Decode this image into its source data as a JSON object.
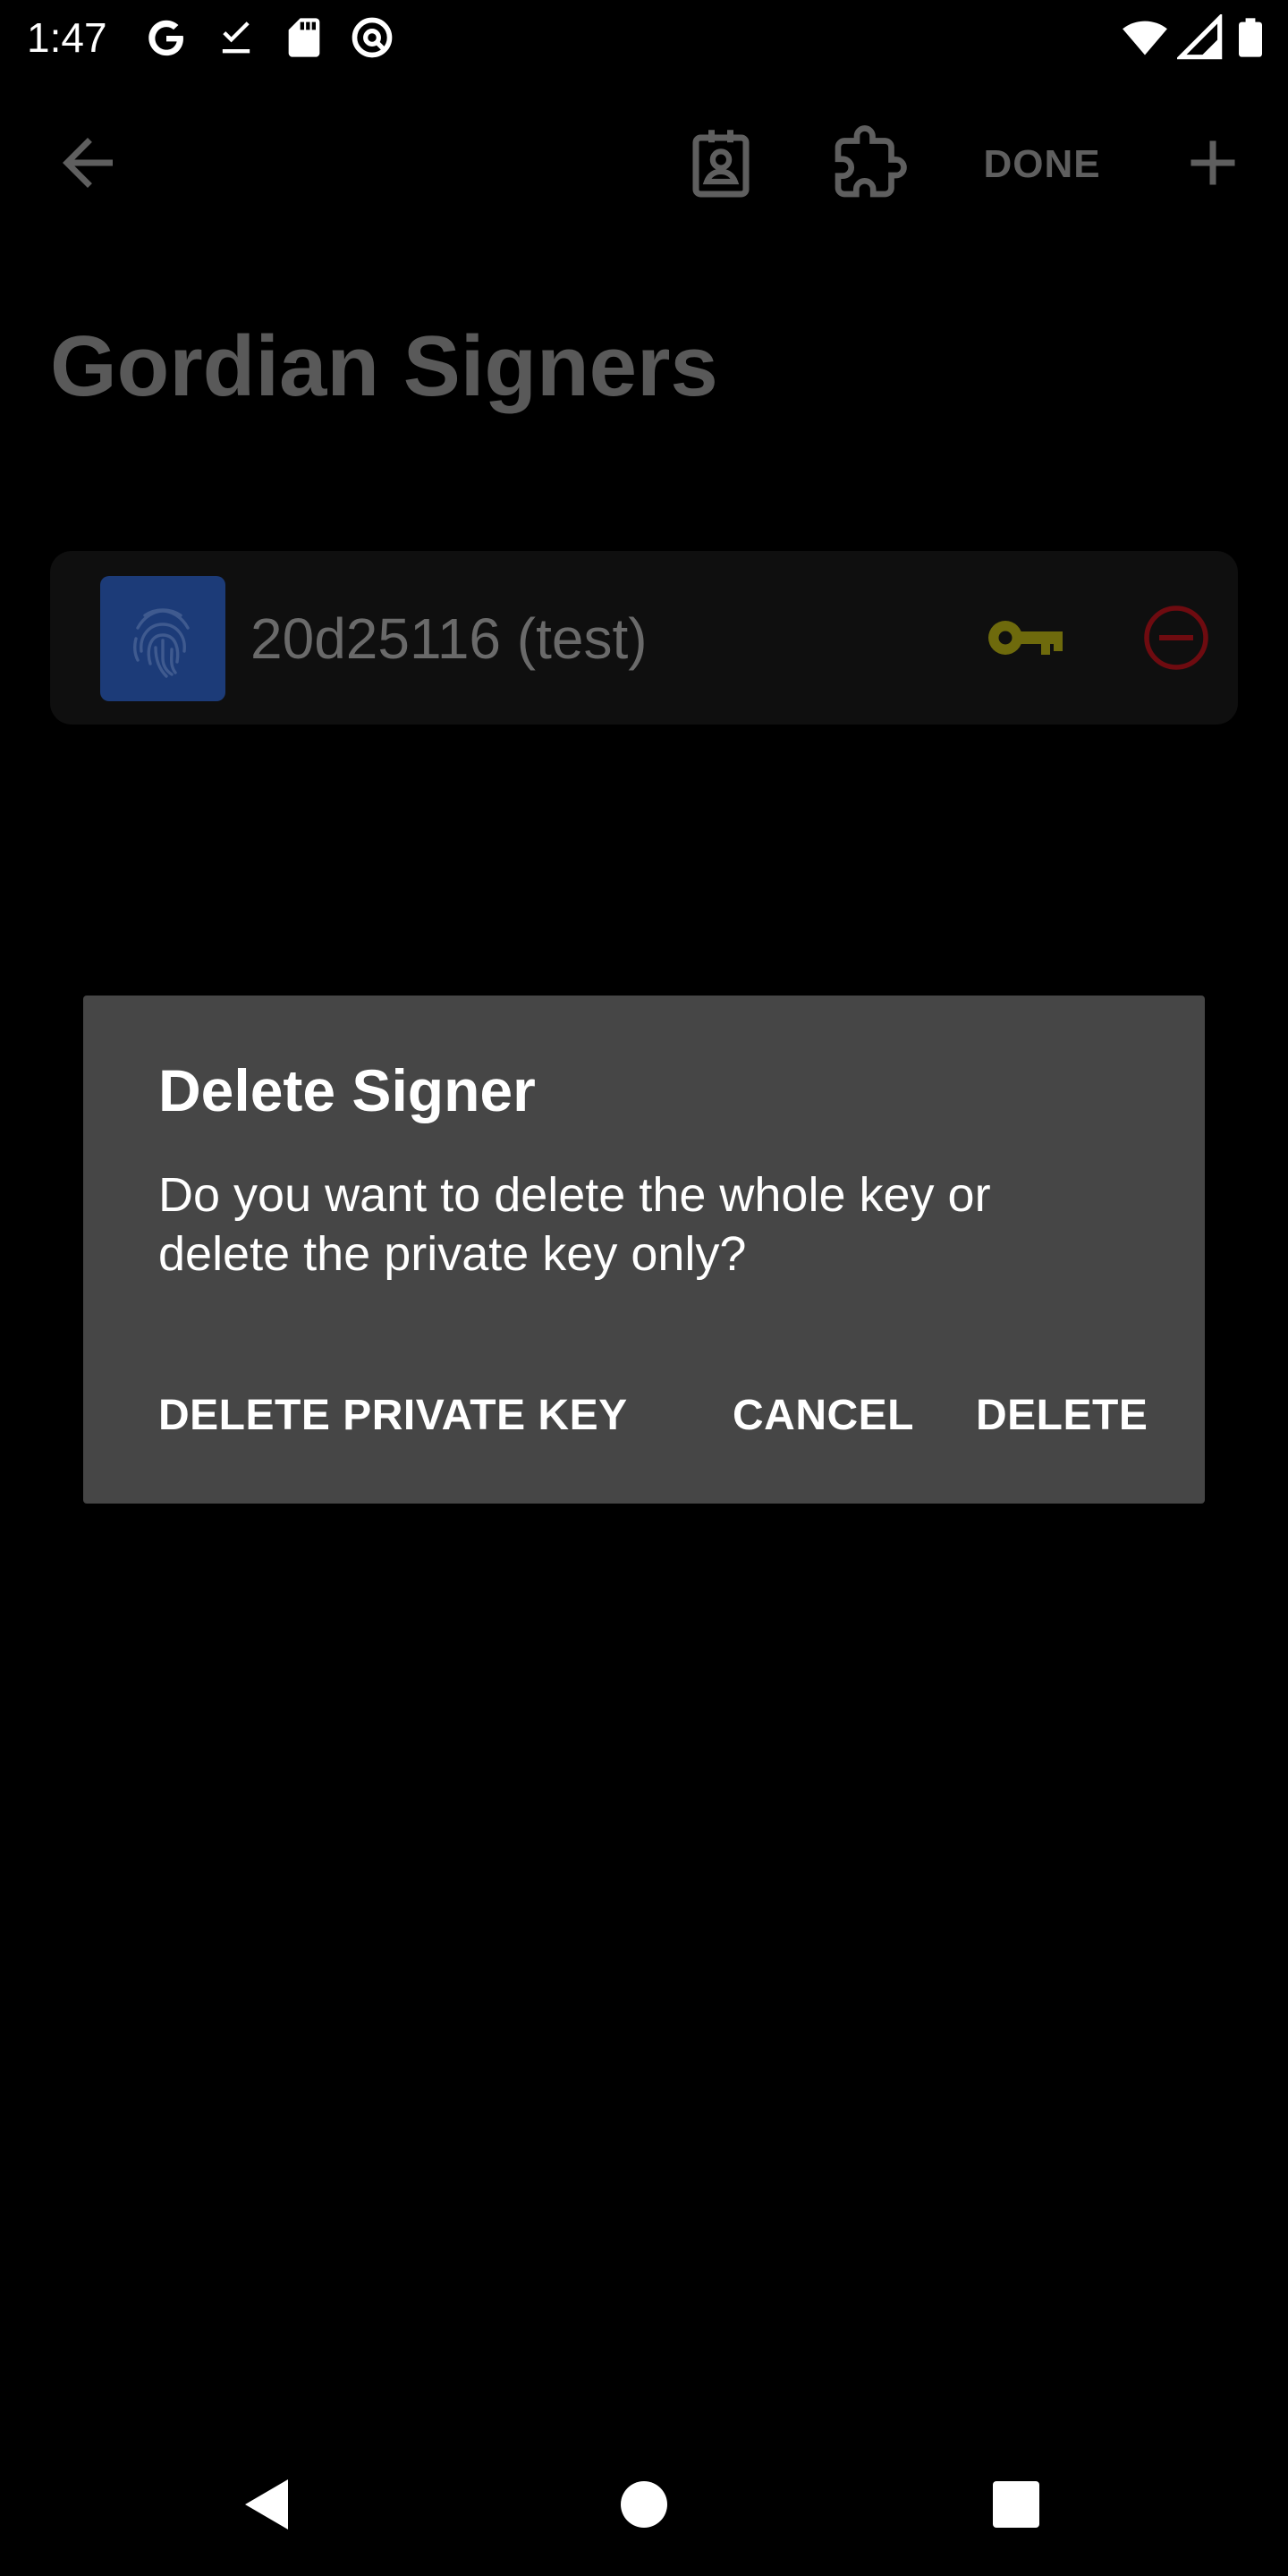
{
  "status_bar": {
    "time": "1:47",
    "icons": [
      "google-icon",
      "download-done-icon",
      "sd-card-icon",
      "at-sign-icon",
      "wifi-icon",
      "signal-icon",
      "battery-icon"
    ]
  },
  "toolbar": {
    "back_icon": "arrow-back-icon",
    "contact_icon": "contact-badge-icon",
    "extension_icon": "puzzle-icon",
    "done_label": "DONE",
    "add_icon": "plus-icon"
  },
  "page": {
    "title": "Gordian Signers"
  },
  "signers": [
    {
      "name": "20d25116 (test)",
      "avatar_icon": "fingerprint-icon",
      "key_icon": "key-icon",
      "remove_icon": "minus-circle-icon"
    }
  ],
  "dialog": {
    "title": "Delete Signer",
    "message": "Do you want to delete the whole key or delete the private key only?",
    "buttons": {
      "delete_private_key": "DELETE PRIVATE KEY",
      "cancel": "CANCEL",
      "delete": "DELETE"
    }
  },
  "nav_bar": {
    "icons": [
      "back-triangle-icon",
      "home-circle-icon",
      "recents-square-icon"
    ]
  },
  "colors": {
    "background": "#000000",
    "dialog_background": "#464646",
    "avatar_background": "#1c3b78",
    "key_icon": "#6e6a0c",
    "remove_icon": "#6e0b10",
    "dimmed_text": "#5f5f5f"
  }
}
